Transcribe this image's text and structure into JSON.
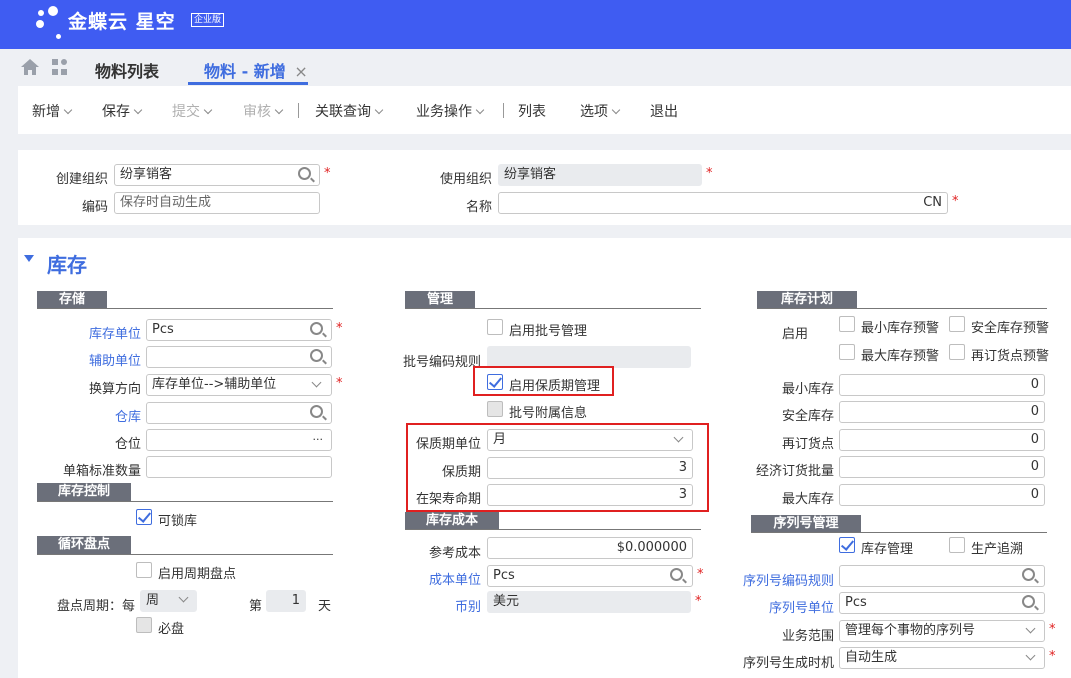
{
  "brand": {
    "name": "金蝶云 星空",
    "badge": "企业版"
  },
  "tabs": [
    {
      "label": "物料列表"
    },
    {
      "label": "物料 - 新增",
      "close": "×"
    }
  ],
  "toolbar": {
    "new": "新增",
    "save": "保存",
    "submit": "提交",
    "audit": "审核",
    "related": "关联查询",
    "ops": "业务操作",
    "list": "列表",
    "options": "选项",
    "exit": "退出"
  },
  "header": {
    "create_org_label": "创建组织",
    "create_org_value": "纷享销客",
    "code_label": "编码",
    "code_placeholder": "保存时自动生成",
    "use_org_label": "使用组织",
    "use_org_value": "纷享销客",
    "name_label": "名称",
    "name_lang": "CN",
    "required": "*"
  },
  "section_title": "库存",
  "storage": {
    "title": "存储",
    "unit_label": "库存单位",
    "unit_value": "Pcs",
    "aux_label": "辅助单位",
    "aux_value": "",
    "dir_label": "换算方向",
    "dir_value": "库存单位-->辅助单位",
    "wh_label": "仓库",
    "wh_value": "",
    "loc_label": "仓位",
    "loc_more": "···",
    "std_label": "单箱标准数量",
    "std_value": ""
  },
  "inv_ctrl": {
    "title": "库存控制",
    "lockable": "可锁库"
  },
  "cycle": {
    "title": "循环盘点",
    "enable": "启用周期盘点",
    "period_label": "盘点周期：每",
    "period_unit": "周",
    "nth_label": "第",
    "nth_value": "1",
    "day_label": "天",
    "must": "必盘"
  },
  "mgmt": {
    "title": "管理",
    "batch": "启用批号管理",
    "batch_rule_label": "批号编码规则",
    "shelf": "启用保质期管理",
    "batch_attach": "批号附属信息",
    "shelf_unit_label": "保质期单位",
    "shelf_unit_value": "月",
    "shelf_label": "保质期",
    "shelf_value": "3",
    "life_label": "在架寿命期",
    "life_value": "3"
  },
  "cost": {
    "title": "库存成本",
    "ref_label": "参考成本",
    "ref_value": "$0.000000",
    "unit_label": "成本单位",
    "unit_value": "Pcs",
    "cur_label": "币别",
    "cur_value": "美元"
  },
  "plan": {
    "title": "库存计划",
    "enable_label": "启用",
    "min_warn": "最小库存预警",
    "safe_warn": "安全库存预警",
    "max_warn": "最大库存预警",
    "reorder_warn": "再订货点预警",
    "min_label": "最小库存",
    "min_value": "0",
    "safe_label": "安全库存",
    "safe_value": "0",
    "reorder_label": "再订货点",
    "reorder_value": "0",
    "eoq_label": "经济订货批量",
    "eoq_value": "0",
    "max_label": "最大库存",
    "max_value": "0"
  },
  "serial": {
    "title": "序列号管理",
    "inv_mgmt": "库存管理",
    "trace": "生产追溯",
    "rule_label": "序列号编码规则",
    "rule_value": "",
    "unit_label": "序列号单位",
    "unit_value": "Pcs",
    "scope_label": "业务范围",
    "scope_value": "管理每个事物的序列号",
    "gen_label": "序列号生成时机",
    "gen_value": "自动生成"
  },
  "colors": {
    "brand": "#3f5cf2",
    "accent": "#3f6ddf",
    "required": "#e02020",
    "highlight": "#e02020"
  }
}
